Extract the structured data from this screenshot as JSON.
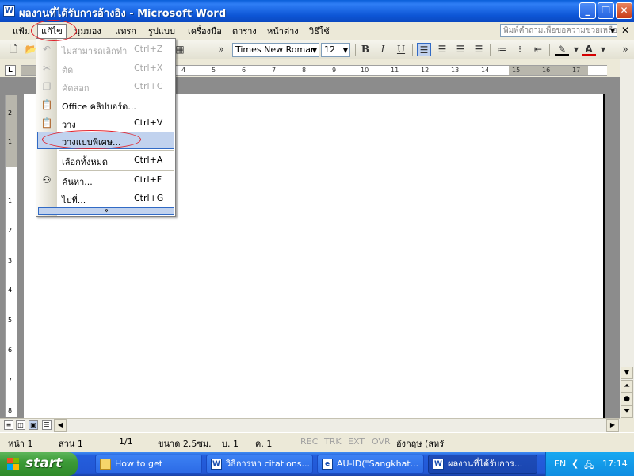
{
  "window": {
    "title": "ผลงานที่ได้รับการอ้างอิง - Microsoft Word",
    "app_icon": "W"
  },
  "menubar": {
    "items": [
      "แฟ้ม",
      "แก้ไข",
      "มุมมอง",
      "แทรก",
      "รูปแบบ",
      "เครื่องมือ",
      "ตาราง",
      "หน้าต่าง",
      "วิธีใช้"
    ],
    "help_placeholder": "พิมพ์คำถามเพื่อขอความช่วยเหลือ"
  },
  "toolbar": {
    "font_name": "Times New Roman",
    "font_size": "12"
  },
  "ruler": {
    "h_ticks": [
      "4",
      "5",
      "6",
      "7",
      "8",
      "9",
      "10",
      "11",
      "12",
      "13",
      "14",
      "15",
      "16",
      "17"
    ],
    "v_ticks": [
      "2",
      "1",
      "1",
      "2",
      "3",
      "4",
      "5",
      "6",
      "7",
      "8"
    ]
  },
  "edit_menu": {
    "items": [
      {
        "label": "ไม่สามารถเลิกทำ",
        "shortcut": "Ctrl+Z",
        "icon": "undo-icon",
        "disabled": true
      },
      {
        "label": "ตัด",
        "shortcut": "Ctrl+X",
        "icon": "cut-icon",
        "disabled": true
      },
      {
        "label": "คัดลอก",
        "shortcut": "Ctrl+C",
        "icon": "copy-icon",
        "disabled": true
      },
      {
        "label": "Office คลิปบอร์ด...",
        "shortcut": "",
        "icon": "clipboard-icon",
        "disabled": false
      },
      {
        "label": "วาง",
        "shortcut": "Ctrl+V",
        "icon": "paste-icon",
        "disabled": false
      },
      {
        "label": "วางแบบพิเศษ...",
        "shortcut": "",
        "icon": "",
        "disabled": false,
        "highlighted": true
      },
      {
        "label": "เลือกทั้งหมด",
        "shortcut": "Ctrl+A",
        "icon": "",
        "disabled": false
      },
      {
        "label": "ค้นหา...",
        "shortcut": "Ctrl+F",
        "icon": "binoculars-icon",
        "disabled": false
      },
      {
        "label": "ไปที่...",
        "shortcut": "Ctrl+G",
        "icon": "",
        "disabled": false
      }
    ],
    "expand_glyph": "»"
  },
  "statusbar": {
    "page": "หน้า 1",
    "section": "ส่วน 1",
    "page_of": "1/1",
    "position": "ขนาด 2.5ซม.",
    "line": "บ. 1",
    "column": "ค. 1",
    "rec": "REC",
    "trk": "TRK",
    "ext": "EXT",
    "ovr": "OVR",
    "language": "อังกฤษ (สหรั"
  },
  "taskbar": {
    "start_label": "start",
    "tasks": [
      {
        "label": "How to get",
        "icon": "folder-icon"
      },
      {
        "label": "วิธีการหา citations...",
        "icon": "word-icon"
      },
      {
        "label": "AU-ID(\"Sangkhat...",
        "icon": "browser-icon"
      },
      {
        "label": "ผลงานที่ได้รับการ...",
        "icon": "word-icon",
        "active": true
      }
    ],
    "tray_lang": "EN",
    "clock": "17:14"
  },
  "colors": {
    "titlebar": "#0a5fd8",
    "highlight": "#c1d2ee",
    "annotation_red": "#e0202a"
  }
}
